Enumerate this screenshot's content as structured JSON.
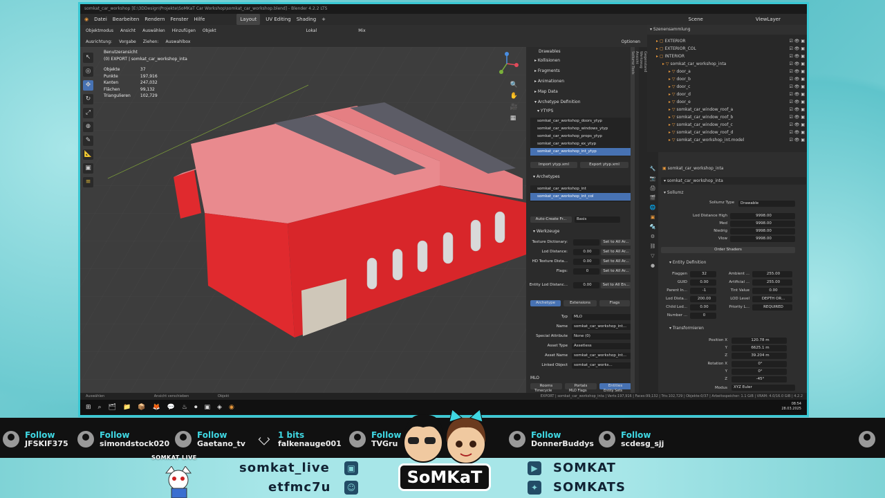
{
  "window": {
    "title": "somkat_car_workshop [E:\\3DDesign\\Projekte\\SoMKaT Car Workshop\\somkat_car_workshop.blend] - Blender 4.2.2 LTS"
  },
  "menubar": {
    "items": [
      "Datei",
      "Bearbeiten",
      "Rendern",
      "Fenster",
      "Hilfe"
    ],
    "workspaces": [
      "Layout",
      "UV Editing",
      "Shading",
      "+"
    ],
    "scene_label": "Scene",
    "viewlayer_label": "ViewLayer"
  },
  "viewport_header": {
    "mode": "Objektmodus",
    "menus": [
      "Ansicht",
      "Auswählen",
      "Hinzufügen",
      "Objekt"
    ],
    "orientation": "Lokal",
    "pivot": "Mix",
    "ausrichtung_label": "Ausrichtung:",
    "ausrichtung_value": "Vorgabe",
    "ziehen_label": "Ziehen:",
    "ziehen_value": "Auswahlbox",
    "optionen": "Optionen"
  },
  "viewport": {
    "view_name": "Benutzeransicht",
    "collection_line": "(0) EXPORT | somkat_car_workshop_inta",
    "stats": [
      {
        "label": "Objekte",
        "value": "37"
      },
      {
        "label": "Punkte",
        "value": "197,916"
      },
      {
        "label": "Kanten",
        "value": "247,032"
      },
      {
        "label": "Flächen",
        "value": "99,132"
      },
      {
        "label": "Triangulieren",
        "value": "102,729"
      }
    ]
  },
  "props_panel": {
    "sections": [
      "Drawables",
      "Kollisionen",
      "Fragments",
      "Animationen",
      "Map Data",
      "Archetype Definition"
    ],
    "ytyps_label": "YTYPS",
    "ytyps": [
      "somkat_car_workshop_doors_ytyp",
      "somkat_car_workshop_windows_ytyp",
      "somkat_car_workshop_props_ytyp",
      "somkat_car_workshop_ex_ytyp",
      "somkat_car_workshop_int_ytyp"
    ],
    "import_btn": "Import ytyp.xml",
    "export_btn": "Export ytyp.xml",
    "archetypes_label": "Archetypes",
    "archetypes": [
      "somkat_car_workshop_int",
      "somkat_car_workshop_int_col"
    ],
    "auto_create": "Auto-Create Fr...",
    "auto_create_value": "Basis",
    "werkzeuge": "Werkzeuge",
    "tool_rows": [
      {
        "label": "Texture Dictionary:",
        "value": "",
        "btn": "Set to All Ar..."
      },
      {
        "label": "Lod Distance:",
        "value": "0.00",
        "btn": "Set to All Ar..."
      },
      {
        "label": "HD Texture Dista...",
        "value": "0.00",
        "btn": "Set to All Ar..."
      },
      {
        "label": "Flags:",
        "value": "0",
        "btn": "Set to All Ar..."
      },
      {
        "label": "Entity Lod Distanc...",
        "value": "0.00",
        "btn": "Set to All En..."
      }
    ],
    "tabs": [
      "Archetype",
      "Extensions",
      "Flags"
    ],
    "fields": [
      {
        "label": "Typ",
        "value": "MLO"
      },
      {
        "label": "Name",
        "value": "somkat_car_workshop_int..."
      },
      {
        "label": "Special Attribute",
        "value": "None (0)"
      },
      {
        "label": "Asset Type",
        "value": "Assetless"
      },
      {
        "label": "Asset Name",
        "value": "somkat_car_workshop_int..."
      },
      {
        "label": "Linked Object",
        "value": "somkat_car_works..."
      }
    ],
    "mlo_label": "MLO",
    "mlo_tabs": [
      "Rooms",
      "Portals",
      "Entities"
    ],
    "mlo_tabs2": [
      "Timecycle",
      "MLO Flags",
      "Entity Sets"
    ]
  },
  "vertical_tabs": [
    "Gegenstand",
    "Werkzeug",
    "Ansicht",
    "Sollumz Tools"
  ],
  "outliner": {
    "header": "Szenensammlung",
    "rows": [
      {
        "indent": 1,
        "name": "EXTERIOR",
        "kind": "coll"
      },
      {
        "indent": 1,
        "name": "EXTERIOR_COL",
        "kind": "coll"
      },
      {
        "indent": 1,
        "name": "INTERIOR",
        "kind": "coll"
      },
      {
        "indent": 2,
        "name": "somkat_car_workshop_inta",
        "kind": "obj"
      },
      {
        "indent": 3,
        "name": "door_a",
        "kind": "obj"
      },
      {
        "indent": 3,
        "name": "door_b",
        "kind": "obj"
      },
      {
        "indent": 3,
        "name": "door_c",
        "kind": "obj"
      },
      {
        "indent": 3,
        "name": "door_d",
        "kind": "obj"
      },
      {
        "indent": 3,
        "name": "door_e",
        "kind": "obj"
      },
      {
        "indent": 3,
        "name": "somkat_car_window_roof_a",
        "kind": "obj"
      },
      {
        "indent": 3,
        "name": "somkat_car_window_roof_b",
        "kind": "obj"
      },
      {
        "indent": 3,
        "name": "somkat_car_window_roof_c",
        "kind": "obj"
      },
      {
        "indent": 3,
        "name": "somkat_car_window_roof_d",
        "kind": "obj"
      },
      {
        "indent": 3,
        "name": "somkat_car_workshop_int.model",
        "kind": "obj"
      }
    ]
  },
  "properties": {
    "object_name": "somkat_car_workshop_inta",
    "object_name2": "somkat_car_workshop_inta",
    "sollumz_label": "Sollumz",
    "sollumz_type_label": "Sollumz Type",
    "sollumz_type_value": "Drawable",
    "lod_rows": [
      {
        "label": "Lod Distance High",
        "value": "9998.00"
      },
      {
        "label": "Med",
        "value": "9998.00"
      },
      {
        "label": "Niedrig",
        "value": "9998.00"
      },
      {
        "label": "Vlow",
        "value": "9998.00"
      }
    ],
    "order_shaders": "Order Shaders",
    "entity_def": "Entity Definition",
    "entity_left": [
      {
        "label": "Flaggen",
        "value": "32"
      },
      {
        "label": "GUID",
        "value": "0.00"
      },
      {
        "label": "Parent In...",
        "value": "-1"
      },
      {
        "label": "Lod Dista...",
        "value": "200.00"
      },
      {
        "label": "Child Lod...",
        "value": "0.00"
      },
      {
        "label": "Number ...",
        "value": "0"
      }
    ],
    "entity_right": [
      {
        "label": "Ambient ...",
        "value": "255.00"
      },
      {
        "label": "Artificial ...",
        "value": "255.00"
      },
      {
        "label": "Tint Value",
        "value": "0.00"
      },
      {
        "label": "LOD Level",
        "value": "DEPTH OR..."
      },
      {
        "label": "Priority L...",
        "value": "REQUIRED"
      }
    ],
    "transform_label": "Transformieren",
    "position": [
      {
        "label": "Position X",
        "value": "120.78 m"
      },
      {
        "label": "Y",
        "value": "6625.1 m"
      },
      {
        "label": "Z",
        "value": "39.204 m"
      }
    ],
    "rotation": [
      {
        "label": "Rotation X",
        "value": "0°"
      },
      {
        "label": "Y",
        "value": "0°"
      },
      {
        "label": "Z",
        "value": "-45°"
      }
    ],
    "modus_label": "Modus",
    "modus_value": "XYZ Euler"
  },
  "statusbar": {
    "left": "Auswählen",
    "mid": "Ansicht verschieben",
    "mid2": "Objekt",
    "right": "EXPORT | somkat_car_workshop_inta | Verts:197,916 | Faces:99,132 | Tris:102,729 | Objekte:0/37 | Arbeitsspeicher: 1.1 GiB | VRAM: 4.0/16.0 GiB | 4.2.2"
  },
  "taskbar": {
    "time": "08:54",
    "date": "28.03.2025"
  },
  "alerts": [
    {
      "type": "Follow",
      "name": "JFSKIF375"
    },
    {
      "type": "Follow",
      "name": "simondstock020"
    },
    {
      "type": "Follow",
      "name": "Gaetano_tv"
    },
    {
      "type": "1 bits",
      "name": "falkenauge001"
    },
    {
      "type": "Follow",
      "name": "TVGru"
    },
    {
      "type": "Follow",
      "name": "DonnerBuddys"
    },
    {
      "type": "Follow",
      "name": "scdesg_sjj"
    }
  ],
  "overlay": {
    "streamer_label": "SOMKAT LIVE",
    "twitch": "somkat_live",
    "discord": "etfmc7u",
    "youtube": "SOMKAT",
    "twitter": "SOMKATS",
    "logo": "SoMKaT"
  },
  "colors": {
    "accent": "#4772b3",
    "frame": "#39c8d4",
    "alert_cyan": "#3fd7e2",
    "building_red": "#e02a2e",
    "roof_pink": "#e98a8e"
  }
}
